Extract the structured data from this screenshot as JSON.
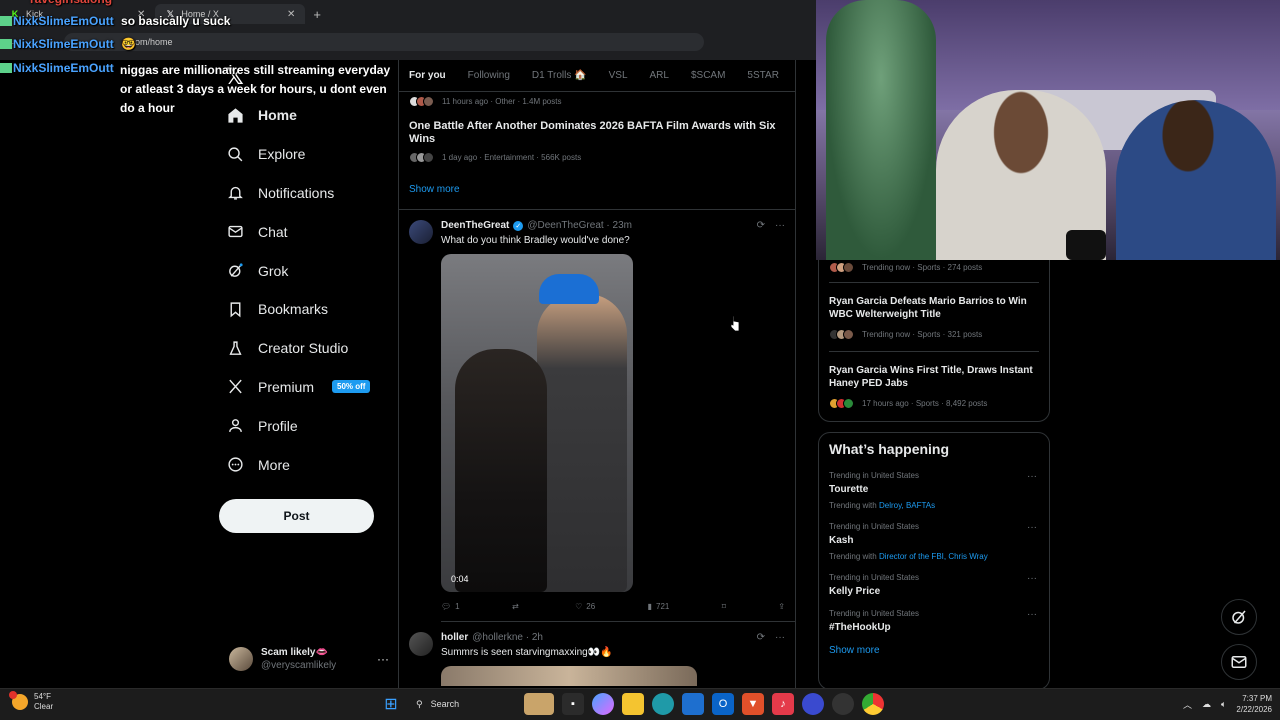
{
  "browser": {
    "tabs": [
      {
        "label": "Kick",
        "favicon": "kick-icon"
      },
      {
        "label": "Home / X",
        "favicon": "x-logo-icon"
      }
    ],
    "address": "x.com/home"
  },
  "chat": [
    {
      "user": "ravegirlsalong",
      "message": ""
    },
    {
      "user": "NixkSlimeEmOutt",
      "message": "so basically u suck"
    },
    {
      "user": "NixkSlimeEmOutt",
      "message": "🤓"
    },
    {
      "user": "NixkSlimeEmOutt",
      "message": "niggas are millionaires still streaming everyday or atleast 3 days a week for hours, u dont even do a hour"
    }
  ],
  "sidebar": {
    "items": [
      {
        "label": "Home",
        "icon": "home-icon"
      },
      {
        "label": "Explore",
        "icon": "search-icon"
      },
      {
        "label": "Notifications",
        "icon": "bell-icon"
      },
      {
        "label": "Chat",
        "icon": "mail-icon"
      },
      {
        "label": "Grok",
        "icon": "grok-icon"
      },
      {
        "label": "Bookmarks",
        "icon": "bookmark-icon"
      },
      {
        "label": "Creator Studio",
        "icon": "flask-icon"
      },
      {
        "label": "Premium",
        "icon": "x-logo-icon",
        "badge": "50% off"
      },
      {
        "label": "Profile",
        "icon": "person-icon"
      },
      {
        "label": "More",
        "icon": "more-circle-icon"
      }
    ],
    "post_label": "Post",
    "account": {
      "name": "Scam likely👄",
      "handle": "@veryscamlikely"
    }
  },
  "feed": {
    "tabs": [
      "For you",
      "Following",
      "D1 Trolls 🏠",
      "VSL",
      "ARL",
      "$SCAM",
      "5STAR"
    ],
    "trend_top_meta": "11 hours ago · Other · 1.4M posts",
    "trend": {
      "title": "One Battle After Another Dominates 2026 BAFTA Film Awards with Six Wins",
      "meta": "1 day ago · Entertainment · 566K posts"
    },
    "show_more": "Show more",
    "tweets": [
      {
        "name": "DeenTheGreat",
        "handle": "@DeenTheGreat · 23m",
        "text": "What do you think Bradley would've done?",
        "media_duration": "0:04",
        "replies": "1",
        "reposts": "",
        "likes": "26",
        "views": "721"
      },
      {
        "name": "holler",
        "handle": "@hollerkne · 2h",
        "text": "Summrs is seen starvingmaxxing👀🔥"
      }
    ]
  },
  "right": {
    "top_meta": "Trending now · Sports · 274 posts",
    "news": [
      {
        "title": "Ryan Garcia Defeats Mario Barrios to Win WBC Welterweight Title",
        "meta": "Trending now · Sports · 321 posts"
      },
      {
        "title": "Ryan Garcia Wins First Title, Draws Instant Haney PED Jabs",
        "meta": "17 hours ago · Sports · 8,492 posts"
      }
    ],
    "happening": {
      "title": "What’s happening",
      "items": [
        {
          "context": "Trending in United States",
          "name": "Tourette",
          "with_prefix": "Trending with",
          "with": "Delroy, BAFTAs"
        },
        {
          "context": "Trending in United States",
          "name": "Kash",
          "with_prefix": "Trending with",
          "with": "Director of the FBI, Chris Wray"
        },
        {
          "context": "Trending in United States",
          "name": "Kelly Price",
          "with_prefix": "",
          "with": ""
        },
        {
          "context": "Trending in United States",
          "name": "#TheHookUp",
          "with_prefix": "",
          "with": ""
        }
      ],
      "show_more": "Show more"
    }
  },
  "taskbar": {
    "temp": "54°F",
    "condition": "Clear",
    "search": "Search",
    "time": "7:37 PM",
    "date": "2/22/2026"
  },
  "colors": {
    "accent": "#1d9bf0",
    "bg": "#000000",
    "border": "#2f3336"
  }
}
